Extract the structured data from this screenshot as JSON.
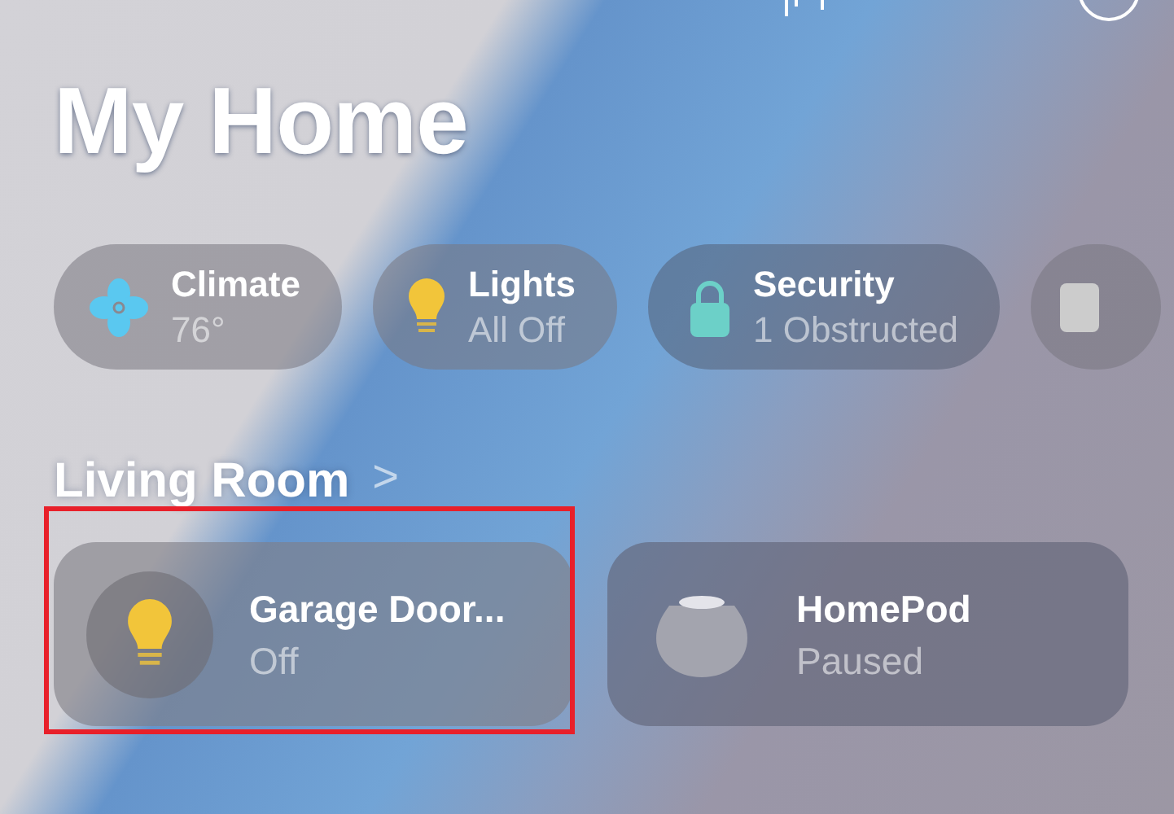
{
  "title": "My Home",
  "categories": [
    {
      "kind": "fan",
      "label": "Climate",
      "status": "76°"
    },
    {
      "kind": "bulb",
      "label": "Lights",
      "status": "All Off"
    },
    {
      "kind": "lock",
      "label": "Security",
      "status": "1 Obstructed"
    },
    {
      "kind": "square"
    }
  ],
  "room": {
    "name": "Living Room",
    "chevron": ">"
  },
  "accessories": [
    {
      "kind": "bulb",
      "name": "Garage Door...",
      "status": "Off",
      "highlighted": true
    },
    {
      "kind": "speaker",
      "name": "HomePod",
      "status": "Paused",
      "highlighted": false
    }
  ]
}
